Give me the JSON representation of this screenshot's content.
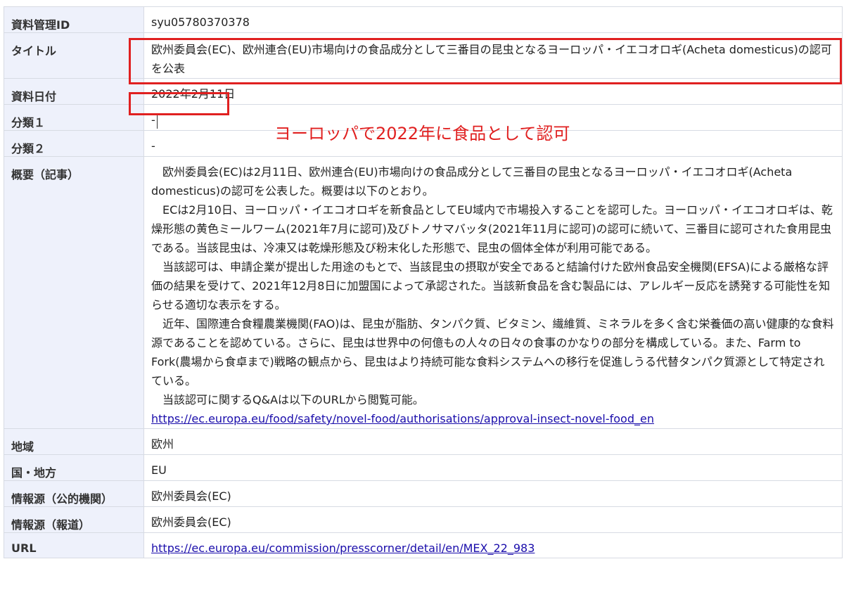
{
  "rows": {
    "id": {
      "label": "資料管理ID",
      "value": "syu05780370378"
    },
    "title": {
      "label": "タイトル",
      "value": "欧州委員会(EC)、欧州連合(EU)市場向けの食品成分として三番目の昆虫となるヨーロッパ・イエコオロギ(Acheta domesticus)の認可を公表"
    },
    "date": {
      "label": "資料日付",
      "value": "2022年2月11日"
    },
    "category1": {
      "label": "分類１",
      "value": "-"
    },
    "category2": {
      "label": "分類２",
      "value": "-"
    },
    "summary": {
      "label": "概要（記事）",
      "paragraphs": [
        "欧州委員会(EC)は2月11日、欧州連合(EU)市場向けの食品成分として三番目の昆虫となるヨーロッパ・イエコオロギ(Acheta domesticus)の認可を公表した。概要は以下のとおり。",
        "ECは2月10日、ヨーロッパ・イエコオロギを新食品としてEU域内で市場投入することを認可した。ヨーロッパ・イエコオロギは、乾燥形態の黄色ミールワーム(2021年7月に認可)及びトノサマバッタ(2021年11月に認可)の認可に続いて、三番目に認可された食用昆虫である。当該昆虫は、冷凍又は乾燥形態及び粉末化した形態で、昆虫の個体全体が利用可能である。",
        "当該認可は、申請企業が提出した用途のもとで、当該昆虫の摂取が安全であると結論付けた欧州食品安全機関(EFSA)による厳格な評価の結果を受けて、2021年12月8日に加盟国によって承認された。当該新食品を含む製品には、アレルギー反応を誘発する可能性を知らせる適切な表示をする。",
        "近年、国際連合食糧農業機関(FAO)は、昆虫が脂肪、タンパク質、ビタミン、繊維質、ミネラルを多く含む栄養価の高い健康的な食料源であることを認めている。さらに、昆虫は世界中の何億もの人々の日々の食事のかなりの部分を構成している。また、Farm to Fork(農場から食卓まで)戦略の観点から、昆虫はより持続可能な食料システムへの移行を促進しうる代替タンパク質源として特定されている。",
        "当該認可に関するQ&Aは以下のURLから閲覧可能。"
      ],
      "link": "https://ec.europa.eu/food/safety/novel-food/authorisations/approval-insect-novel-food_en"
    },
    "region": {
      "label": "地域",
      "value": "欧州"
    },
    "country": {
      "label": "国・地方",
      "value": "EU"
    },
    "source_public": {
      "label": "情報源（公的機関）",
      "value": "欧州委員会(EC)"
    },
    "source_press": {
      "label": "情報源（報道）",
      "value": "欧州委員会(EC)"
    },
    "url": {
      "label": "URL",
      "value": "https://ec.europa.eu/commission/presscorner/detail/en/MEX_22_983"
    }
  },
  "annotation": {
    "text": "ヨーロッパで2022年に食品として認可",
    "color": "#e02020"
  },
  "colors": {
    "header_bg": "#eef1fb",
    "border": "#d7dbe3",
    "link": "#1a0dab",
    "highlight": "#e02020"
  }
}
